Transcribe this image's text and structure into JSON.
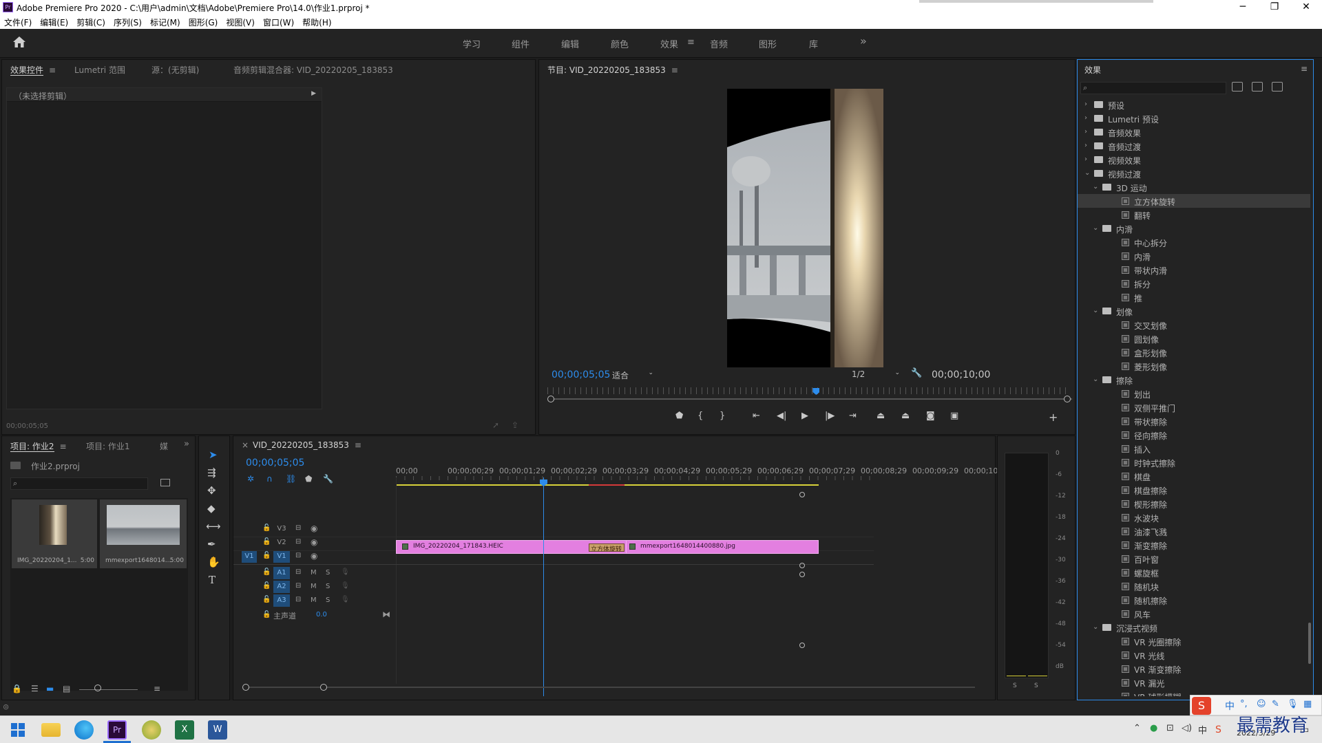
{
  "window": {
    "title": "Adobe Premiere Pro 2020 - C:\\用户\\admin\\文档\\Adobe\\Premiere Pro\\14.0\\作业1.prproj *",
    "minimize": "─",
    "maximize": "❐",
    "close": "✕"
  },
  "menu": [
    "文件(F)",
    "编辑(E)",
    "剪辑(C)",
    "序列(S)",
    "标记(M)",
    "图形(G)",
    "视图(V)",
    "窗口(W)",
    "帮助(H)"
  ],
  "workspaces": {
    "items": [
      "学习",
      "组件",
      "编辑",
      "颜色",
      "效果",
      "音频",
      "图形",
      "库"
    ],
    "active": "效果",
    "more": "»"
  },
  "effect_controls": {
    "tabs": [
      "效果控件",
      "Lumetri 范围",
      "源：(无剪辑)",
      "音频剪辑混合器: VID_20220205_183853"
    ],
    "no_clip": "（未选择剪辑）",
    "timecode": "00;00;05;05"
  },
  "program": {
    "title": "节目: VID_20220205_183853",
    "timecode": "00;00;05;05",
    "fit": "适合",
    "resolution": "1/2",
    "duration": "00;00;10;00",
    "playhead_fraction": 0.515
  },
  "project": {
    "tabs": [
      "项目: 作业2",
      "项目: 作业1",
      "媒"
    ],
    "file": "作业2.prproj",
    "clips": [
      {
        "name": "IMG_20220204_1...",
        "dur": "5:00"
      },
      {
        "name": "mmexport1648014...",
        "dur": "5:00"
      }
    ]
  },
  "timeline": {
    "tab": "VID_20220205_183853",
    "timecode": "00;00;05;05",
    "ruler": [
      "00;00",
      "00;00;00;29",
      "00;00;01;29",
      "00;00;02;29",
      "00;00;03;29",
      "00;00;04;29",
      "00;00;05;29",
      "00;00;06;29",
      "00;00;07;29",
      "00;00;08;29",
      "00;00;09;29",
      "00;00;10;"
    ],
    "video_tracks": [
      "V3",
      "V2",
      "V1"
    ],
    "audio_tracks": [
      "A1",
      "A2",
      "A3"
    ],
    "source_patch": "V1",
    "master": {
      "label": "主声道",
      "value": "0.0"
    },
    "clips": [
      {
        "name": "IMG_20220204_171843.HEIC"
      },
      {
        "name": "mmexport1648014400880.jpg"
      }
    ],
    "transition": "立方体旋转",
    "m_label": "M",
    "s_label": "S"
  },
  "meter": {
    "labels": [
      "0",
      "-6",
      "-12",
      "-18",
      "-24",
      "-30",
      "-36",
      "-42",
      "-48",
      "-54",
      "dB"
    ],
    "solo": [
      "S",
      "S"
    ]
  },
  "effects_panel": {
    "title": "效果",
    "tree": [
      {
        "label": "预设",
        "type": "folder",
        "level": 0,
        "open": false
      },
      {
        "label": "Lumetri 预设",
        "type": "folder",
        "level": 0,
        "open": false
      },
      {
        "label": "音频效果",
        "type": "folder",
        "level": 0,
        "open": false
      },
      {
        "label": "音频过渡",
        "type": "folder",
        "level": 0,
        "open": false
      },
      {
        "label": "视频效果",
        "type": "folder",
        "level": 0,
        "open": false
      },
      {
        "label": "视频过渡",
        "type": "folder",
        "level": 0,
        "open": true
      },
      {
        "label": "3D 运动",
        "type": "folder",
        "level": 1,
        "open": true
      },
      {
        "label": "立方体旋转",
        "type": "fx",
        "level": 2,
        "selected": true
      },
      {
        "label": "翻转",
        "type": "fx",
        "level": 2
      },
      {
        "label": "内滑",
        "type": "folder",
        "level": 1,
        "open": true
      },
      {
        "label": "中心拆分",
        "type": "fx",
        "level": 2
      },
      {
        "label": "内滑",
        "type": "fx",
        "level": 2
      },
      {
        "label": "带状内滑",
        "type": "fx",
        "level": 2
      },
      {
        "label": "拆分",
        "type": "fx",
        "level": 2
      },
      {
        "label": "推",
        "type": "fx",
        "level": 2
      },
      {
        "label": "划像",
        "type": "folder",
        "level": 1,
        "open": true
      },
      {
        "label": "交叉划像",
        "type": "fx",
        "level": 2
      },
      {
        "label": "圆划像",
        "type": "fx",
        "level": 2
      },
      {
        "label": "盒形划像",
        "type": "fx",
        "level": 2
      },
      {
        "label": "菱形划像",
        "type": "fx",
        "level": 2
      },
      {
        "label": "擦除",
        "type": "folder",
        "level": 1,
        "open": true
      },
      {
        "label": "划出",
        "type": "fx",
        "level": 2
      },
      {
        "label": "双侧平推门",
        "type": "fx",
        "level": 2
      },
      {
        "label": "带状擦除",
        "type": "fx",
        "level": 2
      },
      {
        "label": "径向擦除",
        "type": "fx",
        "level": 2
      },
      {
        "label": "插入",
        "type": "fx",
        "level": 2
      },
      {
        "label": "时钟式擦除",
        "type": "fx",
        "level": 2
      },
      {
        "label": "棋盘",
        "type": "fx",
        "level": 2
      },
      {
        "label": "棋盘擦除",
        "type": "fx",
        "level": 2
      },
      {
        "label": "楔形擦除",
        "type": "fx",
        "level": 2
      },
      {
        "label": "水波块",
        "type": "fx",
        "level": 2
      },
      {
        "label": "油漆飞溅",
        "type": "fx",
        "level": 2
      },
      {
        "label": "渐变擦除",
        "type": "fx",
        "level": 2
      },
      {
        "label": "百叶窗",
        "type": "fx",
        "level": 2
      },
      {
        "label": "螺旋框",
        "type": "fx",
        "level": 2
      },
      {
        "label": "随机块",
        "type": "fx",
        "level": 2
      },
      {
        "label": "随机擦除",
        "type": "fx",
        "level": 2
      },
      {
        "label": "风车",
        "type": "fx",
        "level": 2
      },
      {
        "label": "沉浸式视频",
        "type": "folder",
        "level": 1,
        "open": true
      },
      {
        "label": "VR 光圈擦除",
        "type": "fx",
        "level": 2
      },
      {
        "label": "VR 光线",
        "type": "fx",
        "level": 2
      },
      {
        "label": "VR 渐变擦除",
        "type": "fx",
        "level": 2
      },
      {
        "label": "VR 漏光",
        "type": "fx",
        "level": 2
      },
      {
        "label": "VR 球形模糊",
        "type": "fx",
        "level": 2
      }
    ]
  },
  "taskbar": {
    "ime": "中",
    "date": "2022/3/29",
    "watermark": "最需教育"
  },
  "colors": {
    "accent": "#2d8ceb",
    "clip": "#e37fe0",
    "panel": "#232323"
  }
}
